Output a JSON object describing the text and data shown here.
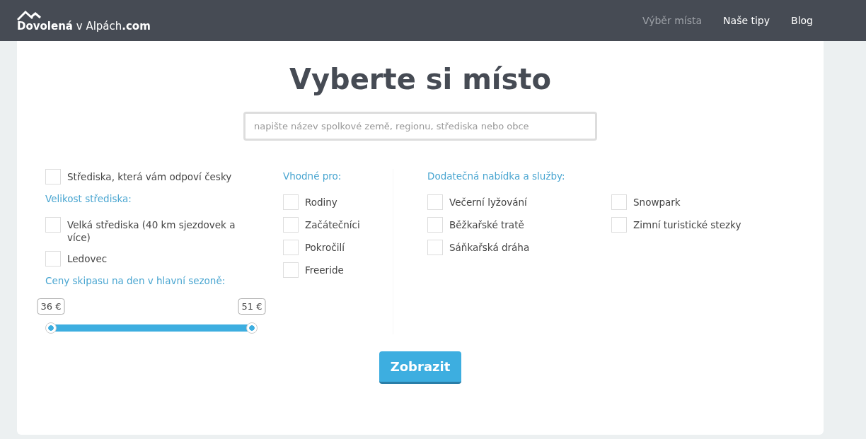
{
  "logo": {
    "text": "**Dovolená** v Alpách**.com**"
  },
  "nav": [
    {
      "label": "Výběr místa",
      "selected": true
    },
    {
      "label": "Naše tipy",
      "selected": false
    },
    {
      "label": "Blog",
      "selected": false
    }
  ],
  "title": "Vyberte si místo",
  "search": {
    "placeholder": "napište název spolkové země, regionu, střediska nebo obce"
  },
  "column_1": {
    "czech": {
      "label": "Střediska, která vám odpoví česky",
      "checked": false
    },
    "size_heading": "Velikost střediska:",
    "size_options": [
      {
        "label": "Velká střediska (40 km sjezdovek a více)",
        "checked": false
      },
      {
        "label": "Ledovec",
        "checked": false
      }
    ],
    "price_heading": "Ceny skipasu na den v hlavní sezoně:",
    "slider": {
      "thumbs": [
        {
          "label": "36 €",
          "level": 0
        },
        {
          "label": "51 €",
          "level": 1
        }
      ]
    }
  },
  "suitable": {
    "heading": "Vhodné pro:",
    "options": [
      {
        "label": "Rodiny",
        "checked": false
      },
      {
        "label": "Začátečníci",
        "checked": false
      },
      {
        "label": "Pokročilí",
        "checked": false
      },
      {
        "label": "Freeride",
        "checked": false
      }
    ]
  },
  "services": {
    "heading": "Dodatečná nabídka a služby:",
    "columns": [
      [
        {
          "label": "Večerní lyžování",
          "checked": false
        },
        {
          "label": "Běžkařské tratě",
          "checked": false
        },
        {
          "label": "Sáňkařská dráha",
          "checked": false
        }
      ],
      [
        {
          "label": "Snowpark",
          "checked": false
        },
        {
          "label": "Zimní turistické stezky",
          "checked": false
        }
      ]
    ]
  },
  "submit": "Zobrazit"
}
